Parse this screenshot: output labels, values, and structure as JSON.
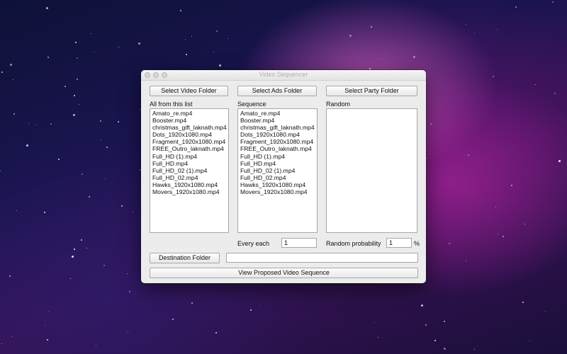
{
  "window": {
    "title": "Video Sequencer"
  },
  "buttons": {
    "select_video_folder": "Select Video Folder",
    "select_ads_folder": "Select Ads Folder",
    "select_party_folder": "Select Party Folder",
    "destination_folder": "Destination Folder",
    "view_sequence": "View Proposed Video Sequence"
  },
  "columns": {
    "all_label": "All from this list",
    "sequence_label": "Sequence",
    "random_label": "Random"
  },
  "all_list": [
    "Amato_re.mp4",
    "Booster.mp4",
    "christmas_gift_laknath.mp4",
    "Dots_1920x1080.mp4",
    "Fragment_1920x1080.mp4",
    "FREE_Outro_laknath.mp4",
    "Full_HD (1).mp4",
    "Full_HD.mp4",
    "Full_HD_02 (1).mp4",
    "Full_HD_02.mp4",
    "Hawks_1920x1080.mp4",
    "Movers_1920x1080.mp4"
  ],
  "sequence_list": [
    "Amato_re.mp4",
    "Booster.mp4",
    "christmas_gift_laknath.mp4",
    "Dots_1920x1080.mp4",
    "Fragment_1920x1080.mp4",
    "FREE_Outro_laknath.mp4",
    "Full_HD (1).mp4",
    "Full_HD.mp4",
    "Full_HD_02 (1).mp4",
    "Full_HD_02.mp4",
    "Hawks_1920x1080.mp4",
    "Movers_1920x1080.mp4"
  ],
  "random_list": [],
  "settings": {
    "every_each_label": "Every each",
    "every_each_value": "1",
    "random_probability_label": "Random probability",
    "random_probability_value": "1",
    "percent_sign": "%"
  },
  "destination": {
    "path": ""
  }
}
